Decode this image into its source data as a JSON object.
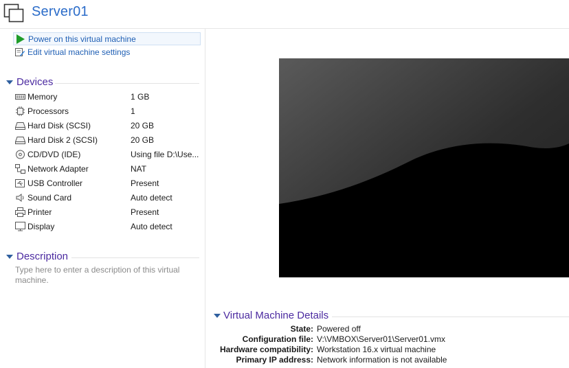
{
  "header": {
    "title": "Server01",
    "icon": "vm-window-icon"
  },
  "actions": [
    {
      "label": "Power on this virtual machine",
      "icon": "power-on-icon"
    },
    {
      "label": "Edit virtual machine settings",
      "icon": "edit-settings-icon"
    }
  ],
  "devices": {
    "heading": "Devices",
    "items": [
      {
        "name": "Memory",
        "value": "1 GB",
        "icon": "memory-icon"
      },
      {
        "name": "Processors",
        "value": "1",
        "icon": "processor-icon"
      },
      {
        "name": "Hard Disk (SCSI)",
        "value": "20 GB",
        "icon": "hard-disk-icon"
      },
      {
        "name": "Hard Disk 2 (SCSI)",
        "value": "20 GB",
        "icon": "hard-disk-icon"
      },
      {
        "name": "CD/DVD (IDE)",
        "value": "Using file D:\\Use...",
        "icon": "cd-dvd-icon"
      },
      {
        "name": "Network Adapter",
        "value": "NAT",
        "icon": "network-adapter-icon"
      },
      {
        "name": "USB Controller",
        "value": "Present",
        "icon": "usb-icon"
      },
      {
        "name": "Sound Card",
        "value": "Auto detect",
        "icon": "speaker-icon"
      },
      {
        "name": "Printer",
        "value": "Present",
        "icon": "printer-icon"
      },
      {
        "name": "Display",
        "value": "Auto detect",
        "icon": "display-icon"
      }
    ]
  },
  "description": {
    "heading": "Description",
    "placeholder": "Type here to enter a description of this virtual machine."
  },
  "details": {
    "heading": "Virtual Machine Details",
    "rows": [
      {
        "key": "State:",
        "value": "Powered off"
      },
      {
        "key": "Configuration file:",
        "value": "V:\\VMBOX\\Server01\\Server01.vmx"
      },
      {
        "key": "Hardware compatibility:",
        "value": "Workstation 16.x virtual machine"
      },
      {
        "key": "Primary IP address:",
        "value": "Network information is not available"
      }
    ]
  },
  "colors": {
    "title_blue": "#2b6cc9",
    "link_blue": "#1f5fb4",
    "section_purple": "#4b2aa0",
    "power_green": "#1f9d2a"
  }
}
